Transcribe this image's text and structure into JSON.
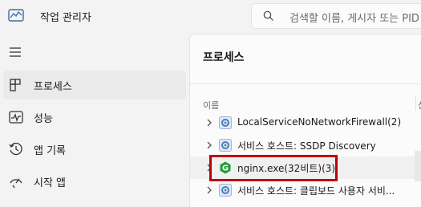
{
  "window": {
    "title": "작업 관리자",
    "search_placeholder": "검색할 이름, 게시자 또는 PID"
  },
  "sidebar": {
    "items": [
      {
        "label": "프로세스",
        "icon": "processes-icon",
        "active": true
      },
      {
        "label": "성능",
        "icon": "performance-icon",
        "active": false
      },
      {
        "label": "앱 기록",
        "icon": "app-history-icon",
        "active": false
      },
      {
        "label": "시작 앱",
        "icon": "startup-apps-icon",
        "active": false
      }
    ]
  },
  "main": {
    "title": "프로세스",
    "column_name": "이름",
    "column_status_partial": "상",
    "rows": [
      {
        "label": "LocalServiceNoNetworkFirewall(2)",
        "icon": "gear-icon"
      },
      {
        "label": "서비스 호스트: SSDP Discovery",
        "icon": "gear-icon"
      },
      {
        "label": "nginx.exe(32비트)(3)",
        "icon": "nginx-icon"
      },
      {
        "label": "서비스 호스트: 클립보드 사용자 서비...",
        "icon": "gear-icon"
      }
    ]
  },
  "colors": {
    "highlight_border": "#c00000",
    "nginx_green": "#1f9b3b",
    "gear_blue": "#4a7fc1"
  }
}
